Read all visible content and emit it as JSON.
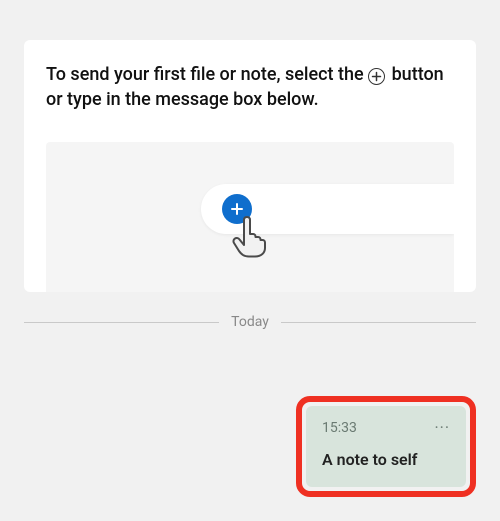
{
  "info_card": {
    "text_before": "To send your first file or note, select the ",
    "text_after": " button or type in the message box below."
  },
  "divider": {
    "label": "Today"
  },
  "message": {
    "time": "15:33",
    "more_label": "···",
    "text": "A note to self"
  }
}
